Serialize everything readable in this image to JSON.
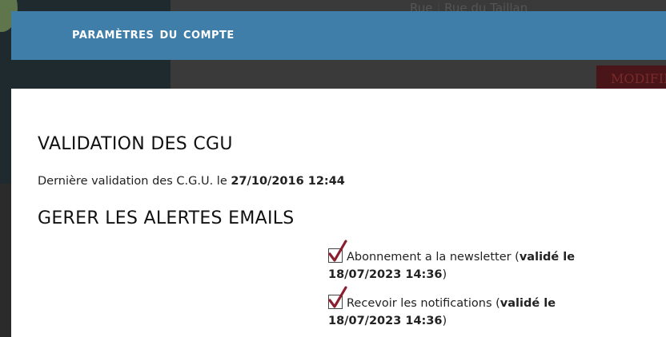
{
  "background": {
    "street_label": "Rue",
    "street_value": "Rue du Taillan",
    "modify_label": "MODIFIER"
  },
  "modal": {
    "title": "Paramètres du compte",
    "cgu": {
      "heading": "VALIDATION DES CGU",
      "text": "Dernière validation des C.G.U. le",
      "date": "27/10/2016 12:44"
    },
    "alerts": {
      "heading": "GERER LES ALERTES EMAILS",
      "options": [
        {
          "label": "Abonnement a la newsletter",
          "status_prefix": "validé le",
          "date": "18/07/2023 14:36",
          "checked": true
        },
        {
          "label": "Recevoir les notifications",
          "status_prefix": "validé le",
          "date": "18/07/2023 14:36",
          "checked": true
        }
      ]
    }
  },
  "colors": {
    "header_bg": "#3e7ea8",
    "check_mark": "#8b1f2e"
  }
}
